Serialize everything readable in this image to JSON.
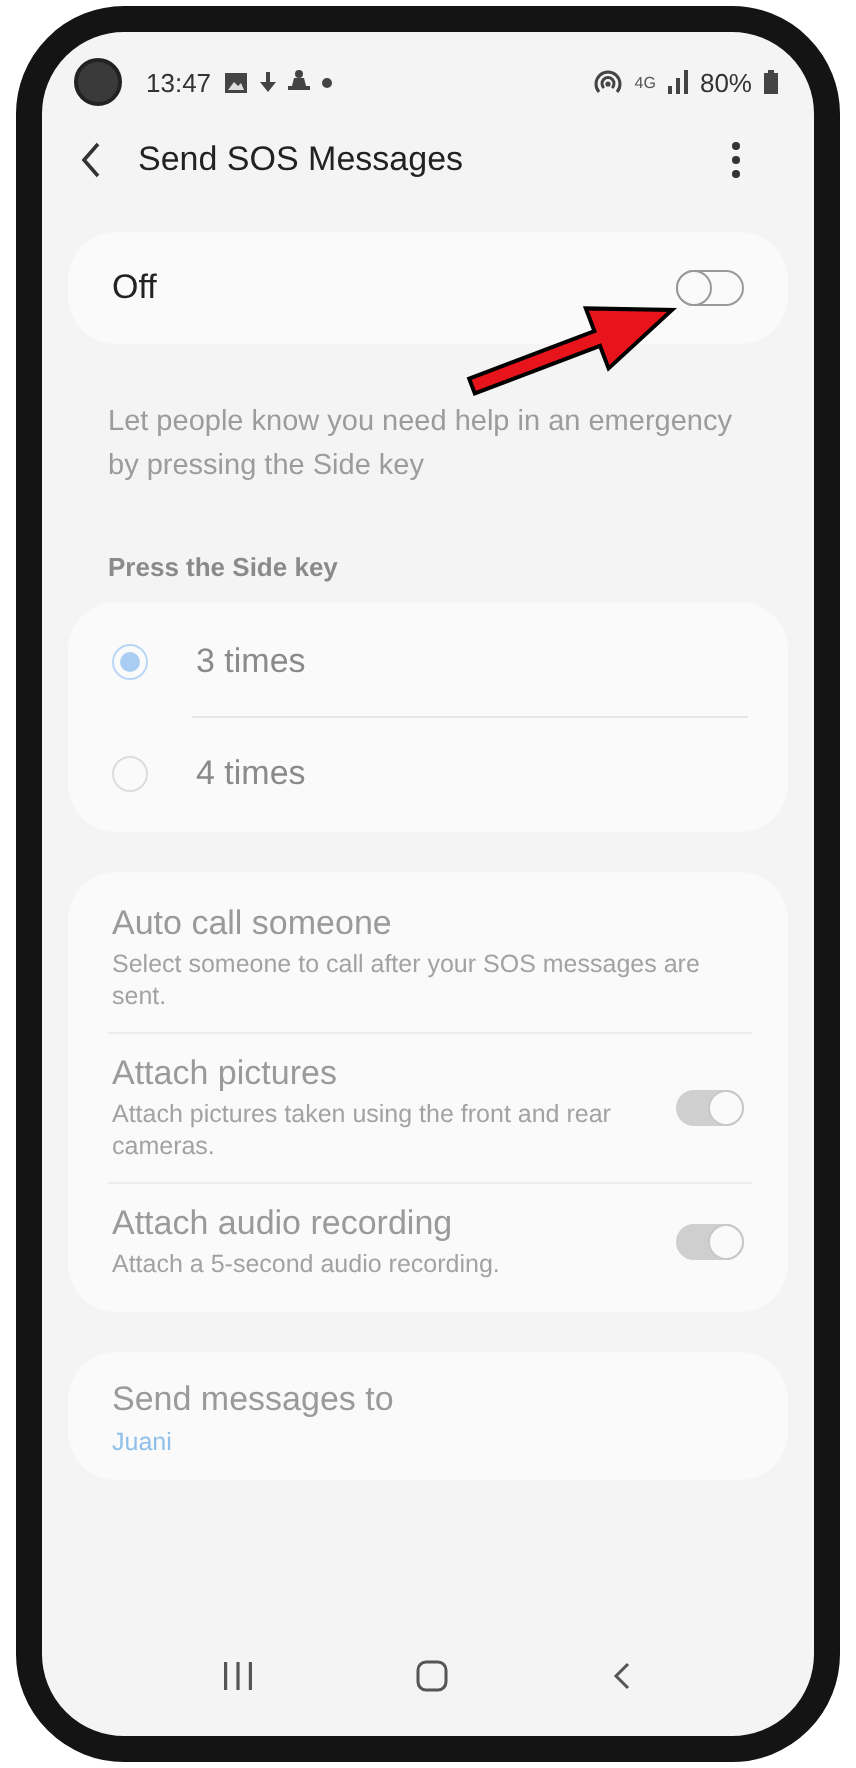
{
  "status_bar": {
    "time": "13:47",
    "network": "4G",
    "battery": "80%"
  },
  "header": {
    "title": "Send SOS Messages"
  },
  "master_switch": {
    "label": "Off",
    "on": false
  },
  "description": "Let people know you need help in an emergency by pressing the Side key",
  "section_title": "Press the Side key",
  "press_options": [
    {
      "label": "3 times",
      "selected": true
    },
    {
      "label": "4 times",
      "selected": false
    }
  ],
  "settings": [
    {
      "kind": "link",
      "title": "Auto call someone",
      "subtitle": "Select someone to call after your SOS messages are sent."
    },
    {
      "kind": "switch",
      "title": "Attach pictures",
      "subtitle": "Attach pictures taken using the front and rear cameras.",
      "on": true
    },
    {
      "kind": "switch",
      "title": "Attach audio recording",
      "subtitle": "Attach a 5-second audio recording.",
      "on": true
    }
  ],
  "recipients": {
    "title": "Send messages to",
    "value": "Juani"
  }
}
